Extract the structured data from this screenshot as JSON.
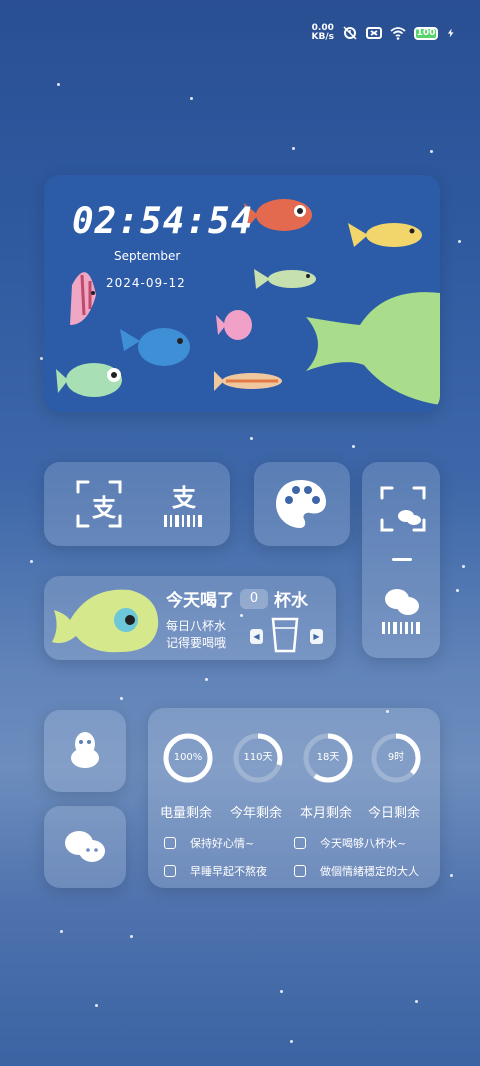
{
  "status_bar": {
    "net_speed": "0.00",
    "net_unit": "KB/s",
    "battery": "100",
    "icons": [
      "alarm-icon",
      "no-sim-icon",
      "wifi-icon",
      "battery-icon",
      "charging-icon"
    ]
  },
  "clock": {
    "time": "02:54:54",
    "month": "September",
    "date": "2024-09-12"
  },
  "pay": {
    "pay_glyph": "支",
    "scan_glyph": "支"
  },
  "water": {
    "line1_prefix": "今天喝了",
    "cups": "0",
    "line1_suffix": "杯水",
    "line2": "每日八杯水",
    "line3": "记得要喝哦",
    "prev": "◀",
    "next": "▶"
  },
  "stats": {
    "items": [
      {
        "value": "100%",
        "label": "电量剩余",
        "fraction": 1.0
      },
      {
        "value": "110天",
        "label": "今年剩余",
        "fraction": 0.3
      },
      {
        "value": "18天",
        "label": "本月剩余",
        "fraction": 0.6
      },
      {
        "value": "9时",
        "label": "今日剩余",
        "fraction": 0.37
      }
    ],
    "todos": [
      "保持好心情~",
      "今天喝够八杯水~",
      "早睡早起不熬夜",
      "做個情緒穩定的大人"
    ]
  },
  "colors": {
    "battery_green": "#58d26a",
    "ring_track": "#9fb3d3"
  }
}
